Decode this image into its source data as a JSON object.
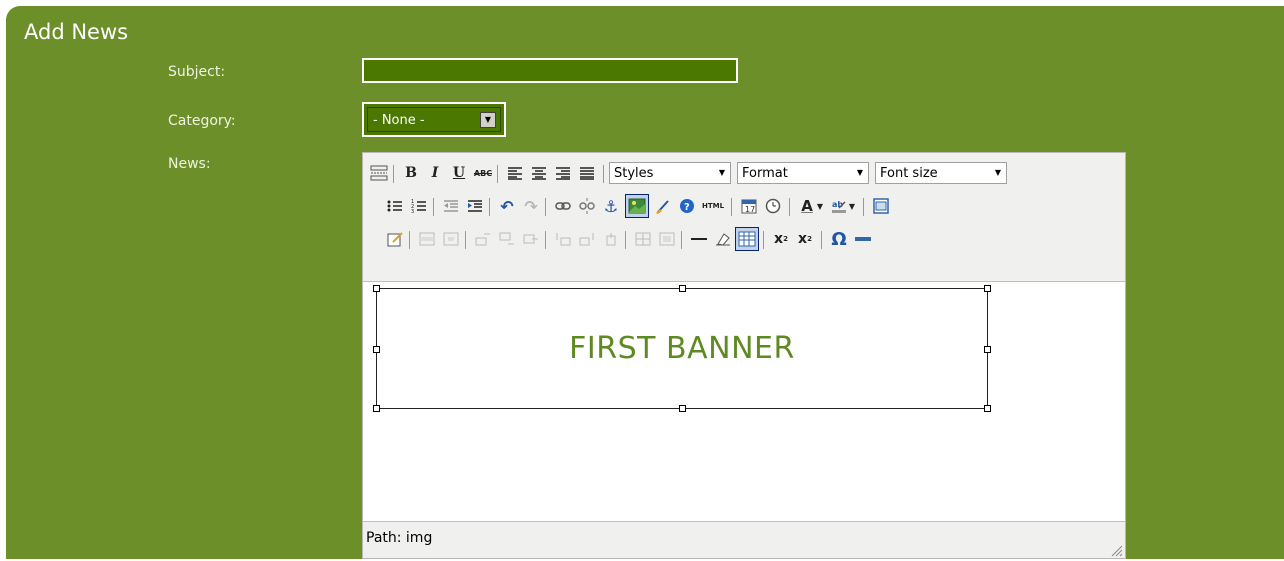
{
  "form": {
    "title": "Add News",
    "subject_label": "Subject:",
    "subject_value": "",
    "category_label": "Category:",
    "category_value": "- None -",
    "news_label": "News:"
  },
  "editor": {
    "styles_value": "Styles",
    "format_value": "Format",
    "fontsize_value": "Font size",
    "content_banner_text": "FIRST BANNER",
    "path_text": "Path: img"
  },
  "icons": {
    "bold": "B",
    "italic": "I",
    "underline": "U",
    "strike": "ABC",
    "html": "HTML",
    "omega": "Ω"
  },
  "colors": {
    "panel_bg": "#6d8f29",
    "input_bg": "#4b7800",
    "banner_text": "#5f8a23"
  }
}
